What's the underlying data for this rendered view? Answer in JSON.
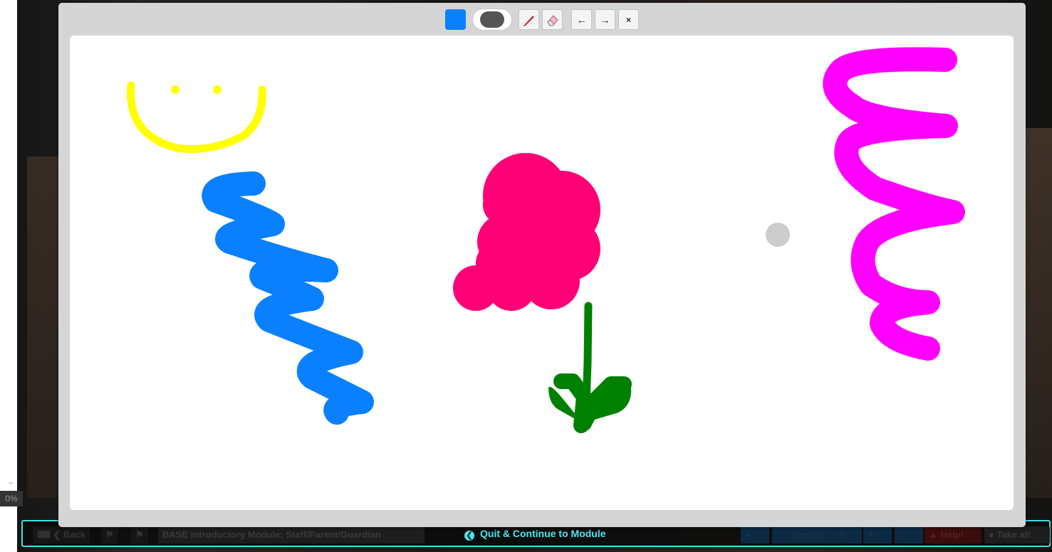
{
  "toolbar": {
    "selected_color": "#0a80ff",
    "color_swatch_icon": "color-swatch",
    "brush_size_icon": "brush-size-pill",
    "pen_icon": "pencil-icon",
    "eraser_icon": "eraser-icon",
    "undo_label": "←",
    "redo_label": "→",
    "close_label": "×"
  },
  "colors": {
    "yellow": "#ffff00",
    "blue": "#0a80ff",
    "pink": "#ff0077",
    "green": "#008000",
    "magenta": "#ff00ff",
    "cursor": "#cccccc",
    "nav_accent": "#3fe0e0"
  },
  "sidebar": {
    "progress": "0%"
  },
  "navbar": {
    "back_label": "Back",
    "module_title": "BASE Introductory Module: Staff/Parent/Guardian",
    "quit_label": "Quit & Continue to Module",
    "language_label": "English",
    "help_label": "Help!",
    "take_alt_label": "Take alt"
  }
}
